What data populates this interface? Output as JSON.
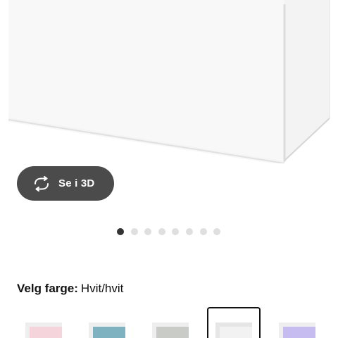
{
  "view_3d": {
    "label": "Se i 3D",
    "icon": "rotate-3d-icon"
  },
  "carousel": {
    "count": 8,
    "active": 0
  },
  "color": {
    "key": "Velg farge:",
    "value": "Hvit/hvit"
  },
  "swatches": [
    {
      "name": "white-pink",
      "color": "#f6d4dc",
      "selected": false
    },
    {
      "name": "white-turquoise",
      "color": "#7fb2c0",
      "selected": false
    },
    {
      "name": "white-grey",
      "color": "#c9cbc6",
      "selected": false
    },
    {
      "name": "white-white",
      "color": "#f2f2f2",
      "selected": true
    },
    {
      "name": "white-lilac",
      "color": "#c6bcf0",
      "selected": false
    }
  ]
}
